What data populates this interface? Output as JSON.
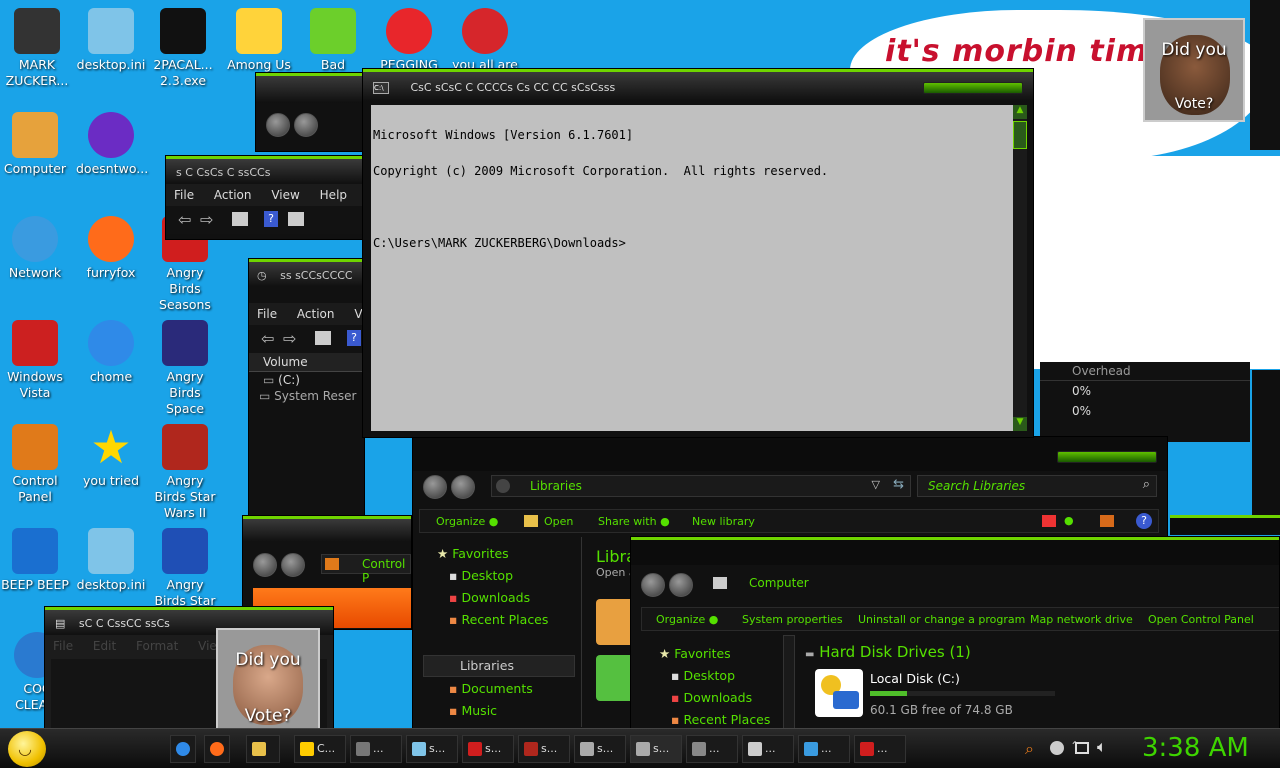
{
  "desktop": {
    "icons": [
      {
        "label": "MARK ZUCKER...",
        "icon": "user-icon",
        "color": "#333333"
      },
      {
        "label": "desktop.ini",
        "icon": "file-icon",
        "color": "#7fc4e8"
      },
      {
        "label": "2PACAL...\n2.3.exe",
        "icon": "console-icon",
        "color": "#111111"
      },
      {
        "label": "Among Us",
        "icon": "game-icon",
        "color": "#ffd33a"
      },
      {
        "label": "Bad Piggies",
        "icon": "pig-icon",
        "color": "#6ccf2b"
      },
      {
        "label": "PEGGING",
        "icon": "app-icon",
        "color": "#e8262b"
      },
      {
        "label": "you all are",
        "icon": "devcpp-icon",
        "color": "#d6262b"
      },
      {
        "label": "Computer",
        "icon": "computer-icon",
        "color": "#e6a23c"
      },
      {
        "label": "doesntwo...",
        "icon": "yahoo-icon",
        "color": "#6b2cc4"
      },
      {
        "label": "Network",
        "icon": "network-icon",
        "color": "#3a9be0"
      },
      {
        "label": "furryfox",
        "icon": "firefox-icon",
        "color": "#ff6b1a"
      },
      {
        "label": "Angry Birds Seasons",
        "icon": "angry-birds-icon",
        "color": "#d01e1e"
      },
      {
        "label": "Windows Vista",
        "icon": "recycle-bin-icon",
        "color": "#cc2020"
      },
      {
        "label": "chome",
        "icon": "chrome-icon",
        "color": "#2f8ae8"
      },
      {
        "label": "Angry Birds Space",
        "icon": "angry-birds-icon",
        "color": "#2a2a7a"
      },
      {
        "label": "Control Panel",
        "icon": "control-panel-icon",
        "color": "#e07a1a"
      },
      {
        "label": "you tried",
        "icon": "star-icon",
        "color": "#ffd700"
      },
      {
        "label": "Angry Birds Star Wars II",
        "icon": "angry-birds-icon",
        "color": "#b0271d"
      },
      {
        "label": "BEEP BEEP",
        "icon": "file-icon",
        "color": "#1a6fd0"
      },
      {
        "label": "desktop.ini",
        "icon": "file-icon",
        "color": "#7fc4e8"
      },
      {
        "label": "Angry Birds Star Wars",
        "icon": "angry-birds-icon",
        "color": "#1f4fb5"
      },
      {
        "label": "COC CLEA...",
        "icon": "app-icon",
        "color": "#2a7ad0"
      }
    ]
  },
  "meme": {
    "text": "it's morbin  tim"
  },
  "poster_top": {
    "line1": "Did you",
    "line2": "Vote?"
  },
  "poster_bottom": {
    "line1": "Did you",
    "line2": "Vote?"
  },
  "cmd": {
    "title": "CsC sCsC  C  CCCCs Cs  CC CC sCsCsss",
    "lines": [
      "Microsoft Windows [Version 6.1.7601]",
      "Copyright (c) 2009 Microsoft Corporation.  All rights reserved.",
      "",
      "C:\\Users\\MARK ZUCKERBERG\\Downloads>"
    ]
  },
  "mmc1": {
    "title": "s C  CsCs C ssCCs",
    "menu": [
      "File",
      "Action",
      "View",
      "Help"
    ]
  },
  "mmc2": {
    "title": "ss  sCCsCCCC",
    "menu": [
      "File",
      "Action",
      "Vi"
    ],
    "column": "Volume",
    "rows": [
      "(C:)",
      "System Reser"
    ],
    "overhead_header": "Overhead",
    "overhead_rows": [
      "0%",
      "0%"
    ]
  },
  "control_panel": {
    "address": "Control P"
  },
  "notepad": {
    "title": "sC  C CssCC ssCs",
    "menu": [
      "File",
      "Edit",
      "Format",
      "View"
    ]
  },
  "libraries": {
    "address": "Libraries",
    "search_placeholder": "Search Libraries",
    "commands": [
      "Organize",
      "Open",
      "Share with",
      "New library"
    ],
    "favorites_header": "Favorites",
    "favorites": [
      "Desktop",
      "Downloads",
      "Recent Places"
    ],
    "libraries_header": "Libraries",
    "libraries": [
      "Documents",
      "Music"
    ],
    "content_title": "Libra",
    "content_sub": "Open a"
  },
  "computer": {
    "address": "Computer",
    "commands": [
      "Organize",
      "System properties",
      "Uninstall or change a program",
      "Map network drive",
      "Open Control Panel"
    ],
    "favorites_header": "Favorites",
    "favorites": [
      "Desktop",
      "Downloads",
      "Recent Places"
    ],
    "group": "Hard Disk Drives (1)",
    "drive_name": "Local Disk (C:)",
    "drive_free": "60.1 GB free of 74.8 GB",
    "drive_used_fraction": 0.2
  },
  "taskbar": {
    "items": [
      {
        "label": "",
        "color": "#2f8ae8"
      },
      {
        "label": "",
        "color": "#ff6b1a"
      },
      {
        "label": "",
        "color": "#e8c04a"
      },
      {
        "label": "C...",
        "color": "#ffcc00"
      },
      {
        "label": "...",
        "color": "#777777"
      },
      {
        "label": "s...",
        "color": "#7fc4e8"
      },
      {
        "label": "s...",
        "color": "#d01e1e"
      },
      {
        "label": "s...",
        "color": "#b0271d"
      },
      {
        "label": "s...",
        "color": "#aaaaaa"
      },
      {
        "label": "s...",
        "color": "#aaaaaa"
      },
      {
        "label": "...",
        "color": "#888888"
      },
      {
        "label": "...",
        "color": "#cccccc"
      },
      {
        "label": "...",
        "color": "#3a9be0"
      },
      {
        "label": "...",
        "color": "#d01e1e"
      }
    ],
    "clock": "3:38 AM"
  }
}
